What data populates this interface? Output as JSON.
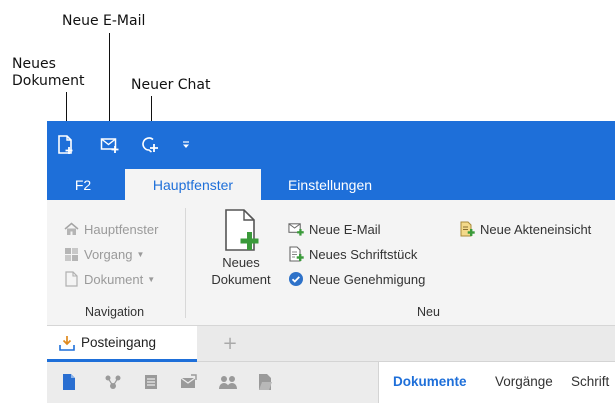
{
  "callouts": {
    "new_email": "Neue E-Mail",
    "new_document_line1": "Neues",
    "new_document_line2": "Dokument",
    "new_chat": "Neuer Chat"
  },
  "quick_access": [
    {
      "icon": "new-document-icon"
    },
    {
      "icon": "new-email-icon"
    },
    {
      "icon": "new-chat-icon"
    },
    {
      "icon": "customize-dropdown-icon"
    }
  ],
  "tabs": [
    {
      "label": "F2",
      "active": false
    },
    {
      "label": "Hauptfenster",
      "active": true
    },
    {
      "label": "Einstellungen",
      "active": false
    }
  ],
  "ribbon": {
    "navigation": {
      "label": "Navigation",
      "items": [
        {
          "label": "Hauptfenster",
          "icon": "home-icon",
          "dropdown": false
        },
        {
          "label": "Vorgang",
          "icon": "case-icon",
          "dropdown": true
        },
        {
          "label": "Dokument",
          "icon": "document-icon",
          "dropdown": true
        }
      ]
    },
    "neu": {
      "label": "Neu",
      "big_button": {
        "line1": "Neues",
        "line2": "Dokument",
        "icon": "new-document-large-icon"
      },
      "items": [
        {
          "label": "Neue E-Mail",
          "icon": "new-email-icon"
        },
        {
          "label": "Neues Schriftstück",
          "icon": "new-letter-icon"
        },
        {
          "label": "Neue Genehmigung",
          "icon": "approval-icon"
        }
      ],
      "extra": {
        "label": "Neue Akteneinsicht",
        "icon": "file-inspection-icon"
      }
    }
  },
  "document_tabs": {
    "active": {
      "label": "Posteingang",
      "icon": "inbox-icon"
    },
    "add_icon": "plus-icon"
  },
  "sidebar_icons": [
    "document-icon",
    "network-icon",
    "list-icon",
    "mail-icon",
    "people-icon",
    "folder-icon"
  ],
  "sub_tabs": [
    {
      "label": "Dokumente",
      "active": true
    },
    {
      "label": "Vorgänge",
      "active": false
    },
    {
      "label": "Schrift",
      "active": false
    }
  ],
  "colors": {
    "accent": "#1e6fd9",
    "green": "#3a9a3a",
    "disabled": "#9a9a9a"
  }
}
